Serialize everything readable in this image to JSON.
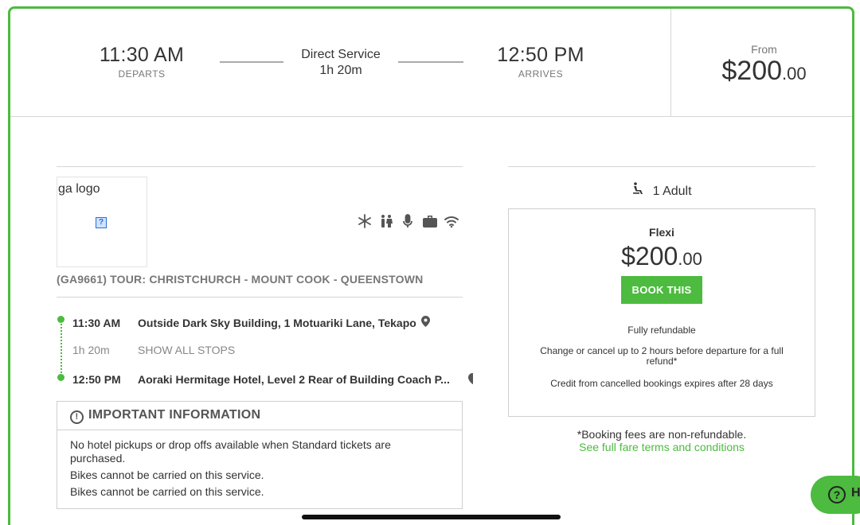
{
  "header": {
    "depart_time": "11:30 AM",
    "depart_label": "DEPARTS",
    "service_type": "Direct Service",
    "duration": "1h 20m",
    "arrive_time": "12:50 PM",
    "arrive_label": "ARRIVES",
    "from_label": "From",
    "price_main": "$200",
    "price_cents": ".00"
  },
  "operator": {
    "logo_alt": "ga logo",
    "amenities": [
      "snowflake-icon",
      "restroom-icon",
      "microphone-icon",
      "luggage-icon",
      "wifi-icon"
    ],
    "tour_name": "(GA9661) TOUR: CHRISTCHURCH - MOUNT COOK - QUEENSTOWN"
  },
  "itinerary": {
    "stops": [
      {
        "time": "11:30 AM",
        "location": "Outside Dark Sky Building, 1 Motuariki Lane, Tekapo"
      },
      {
        "time": "1h 20m",
        "location": "SHOW ALL STOPS"
      },
      {
        "time": "12:50 PM",
        "location": "Aoraki Hermitage Hotel, Level 2 Rear of Building Coach P..."
      }
    ]
  },
  "important_info": {
    "title": "IMPORTANT INFORMATION",
    "lines": [
      "No hotel pickups or drop offs available when Standard tickets are purchased.",
      "Bikes cannot be carried on this service.",
      "Bikes cannot be carried on this service."
    ]
  },
  "passengers": {
    "label": "1 Adult"
  },
  "fare": {
    "name": "Flexi",
    "price_main": "$200",
    "price_cents": ".00",
    "book_label": "BOOK THIS",
    "note1": "Fully refundable",
    "note2": "Change or cancel up to 2 hours before departure for a full refund*",
    "note3": "Credit from cancelled bookings expires after 28 days"
  },
  "terms": {
    "fees_note": "*Booking fees are non-refundable.",
    "link": "See full fare terms and conditions"
  },
  "help": {
    "label": "H"
  },
  "colors": {
    "accent": "#4cbb3f"
  }
}
